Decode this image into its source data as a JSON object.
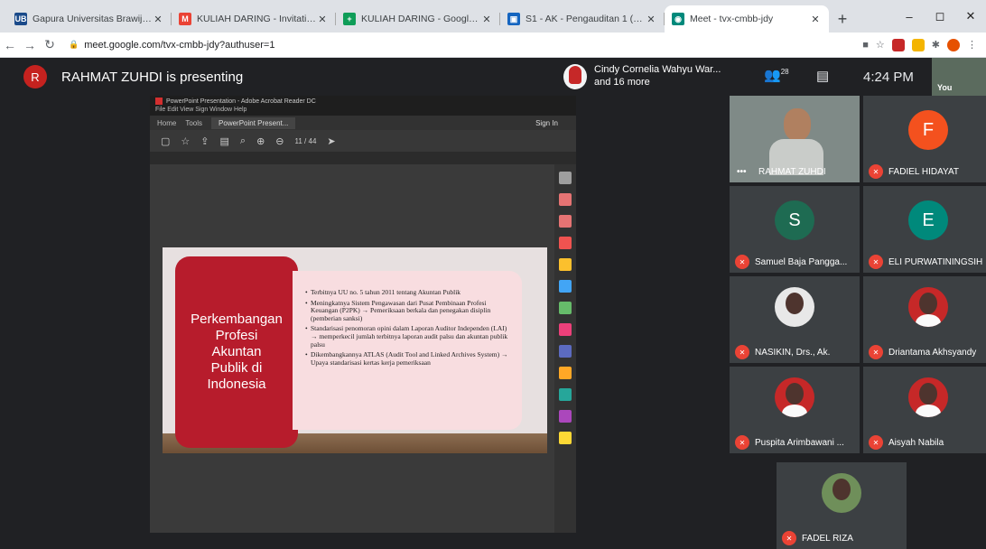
{
  "browser": {
    "tabs": [
      {
        "label": "Gapura Universitas Brawijaya",
        "fav": "UB",
        "fav_color": "#1a4a8a",
        "active": false
      },
      {
        "label": "KULIAH DARING - Invitation to",
        "fav": "M",
        "fav_color": "#ea4335",
        "active": false
      },
      {
        "label": "KULIAH DARING - Google She",
        "fav": "+",
        "fav_color": "#0f9d58",
        "active": false
      },
      {
        "label": "S1 - AK - Pengauditan 1 (CC)",
        "fav": "▣",
        "fav_color": "#1565c0",
        "active": false
      },
      {
        "label": "Meet - tvx-cmbb-jdy",
        "fav": "◉",
        "fav_color": "#00897b",
        "active": true
      }
    ],
    "new_tab": "+",
    "url": "meet.google.com/tvx-cmbb-jdy?authuser=1",
    "window_controls": [
      "–",
      "◻",
      "✕"
    ]
  },
  "meet": {
    "presenter_initial": "R",
    "presenter_text": "RAHMAT ZUHDI is presenting",
    "others_line1": "Cindy Cornelia Wahyu War...",
    "others_line2": "and 16 more",
    "people_count": "28",
    "time": "4:24 PM",
    "you_label": "You",
    "participants": [
      {
        "name": "RAHMAT ZUHDI",
        "type": "video",
        "color": "#7f8a87"
      },
      {
        "name": "FADIEL HIDAYAT",
        "initial": "F",
        "type": "letter",
        "color": "#f4511e"
      },
      {
        "name": "Samuel Baja Pangga...",
        "initial": "S",
        "type": "letter",
        "color": "#1e6b52"
      },
      {
        "name": "ELI PURWATININGSIH",
        "initial": "E",
        "type": "letter",
        "color": "#00897b"
      },
      {
        "name": "NASIKIN, Drs., Ak.",
        "type": "photo",
        "color": "#e8e8e8"
      },
      {
        "name": "Driantama Akhsyandy",
        "type": "photo",
        "color": "#c62828"
      },
      {
        "name": "Puspita Arimbawani ...",
        "type": "photo",
        "color": "#c62828"
      },
      {
        "name": "Aisyah Nabila",
        "type": "photo",
        "color": "#c62828"
      },
      {
        "name": "FADEL RIZA",
        "type": "photo",
        "color": "#6f8f5a"
      }
    ]
  },
  "acrobat": {
    "window_title": "PowerPoint Presentation - Adobe Acrobat Reader DC",
    "menu": "File  Edit  View  Sign  Window  Help",
    "tabs": [
      "Home",
      "Tools",
      "PowerPoint Present..."
    ],
    "sign_in": "Sign In",
    "page_indicator": "11 / 44"
  },
  "slide": {
    "title": "Perkembangan\nProfesi\nAkuntan\nPublik di\nIndonesia",
    "bullets": [
      "Terbitnya UU no. 5 tahun 2011 tentang Akuntan Publik",
      "Meningkatnya Sistem Pengawasan dari Pusat Pembinaan Profesi Keuangan (P2PK) → Pemeriksaan berkala dan penegakan disiplin (pemberian sanksi)",
      "Standarisasi penomoran opini dalam Laporan Auditor Independen (LAI) → memperkecil jumlah terbitnya laporan audit palsu dan akuntan publik palsu",
      "Dikembangkannya ATLAS (Audit Tool and Linked Archives System) → Upaya standarisasi kertas kerja pemeriksaan"
    ]
  }
}
